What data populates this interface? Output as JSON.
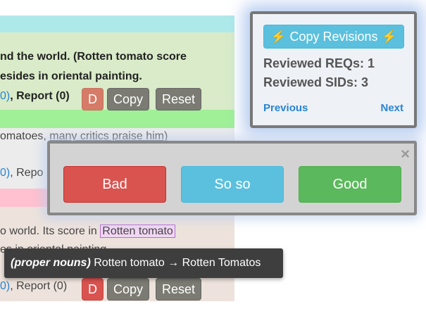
{
  "review": {
    "line1": "nd the world. (Rotten tomato score",
    "line2": "esides in oriental painting.",
    "row1": {
      "paren_open": "0)",
      "report_label": ", Report (0)"
    },
    "row1_buttons": {
      "d": "D",
      "copy": "Copy",
      "reset": "Reset"
    },
    "grey_text_prefix": "omatoes, ",
    "grey_text_link": "many critics praise him)",
    "row2": {
      "paren_open": "0)",
      "report_label": ", Repo"
    },
    "beige_prefix": "o world. Its score in ",
    "beige_highlight": "Rotten tomato",
    "beige_line2": "es in oriental painting.",
    "row3": {
      "paren_open": "0)",
      "report_label": ", Report (0)"
    },
    "row3_buttons": {
      "d": "D",
      "copy": "Copy",
      "reset": "Reset"
    }
  },
  "revisions_panel": {
    "copy_button_label": "Copy Revisions",
    "bolt_icon": "⚡",
    "reviewed_reqs": "Reviewed REQs: 1",
    "reviewed_sids": "Reviewed SIDs: 3",
    "previous": "Previous",
    "next": "Next"
  },
  "rating_dialog": {
    "close": "×",
    "bad": "Bad",
    "so_so": "So so",
    "good": "Good"
  },
  "tooltip": {
    "category": "(proper nouns)",
    "change": "Rotten tomato → Rotten Tomatos"
  },
  "colors": {
    "info": "#5bc0de",
    "danger": "#d9534f",
    "success": "#5cb85c",
    "link": "#2a84d0"
  }
}
